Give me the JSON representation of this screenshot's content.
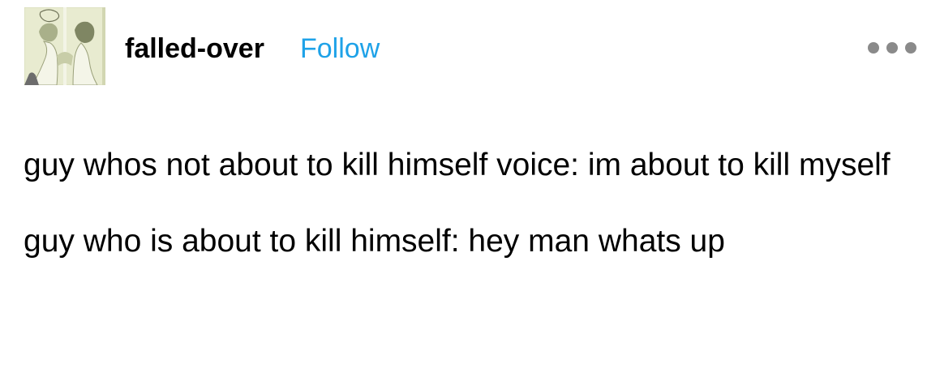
{
  "post": {
    "username": "falled-over",
    "follow_label": "Follow",
    "more_icon": "more-horizontal-icon",
    "paragraphs": [
      "guy whos not about to kill himself voice: im about to kill myself",
      "guy who is about to kill himself: hey man whats up"
    ]
  },
  "colors": {
    "follow": "#1ea2e8",
    "text": "#000000",
    "more_dots": "#8a8a8a",
    "avatar_bg": "#e6e8c7"
  }
}
